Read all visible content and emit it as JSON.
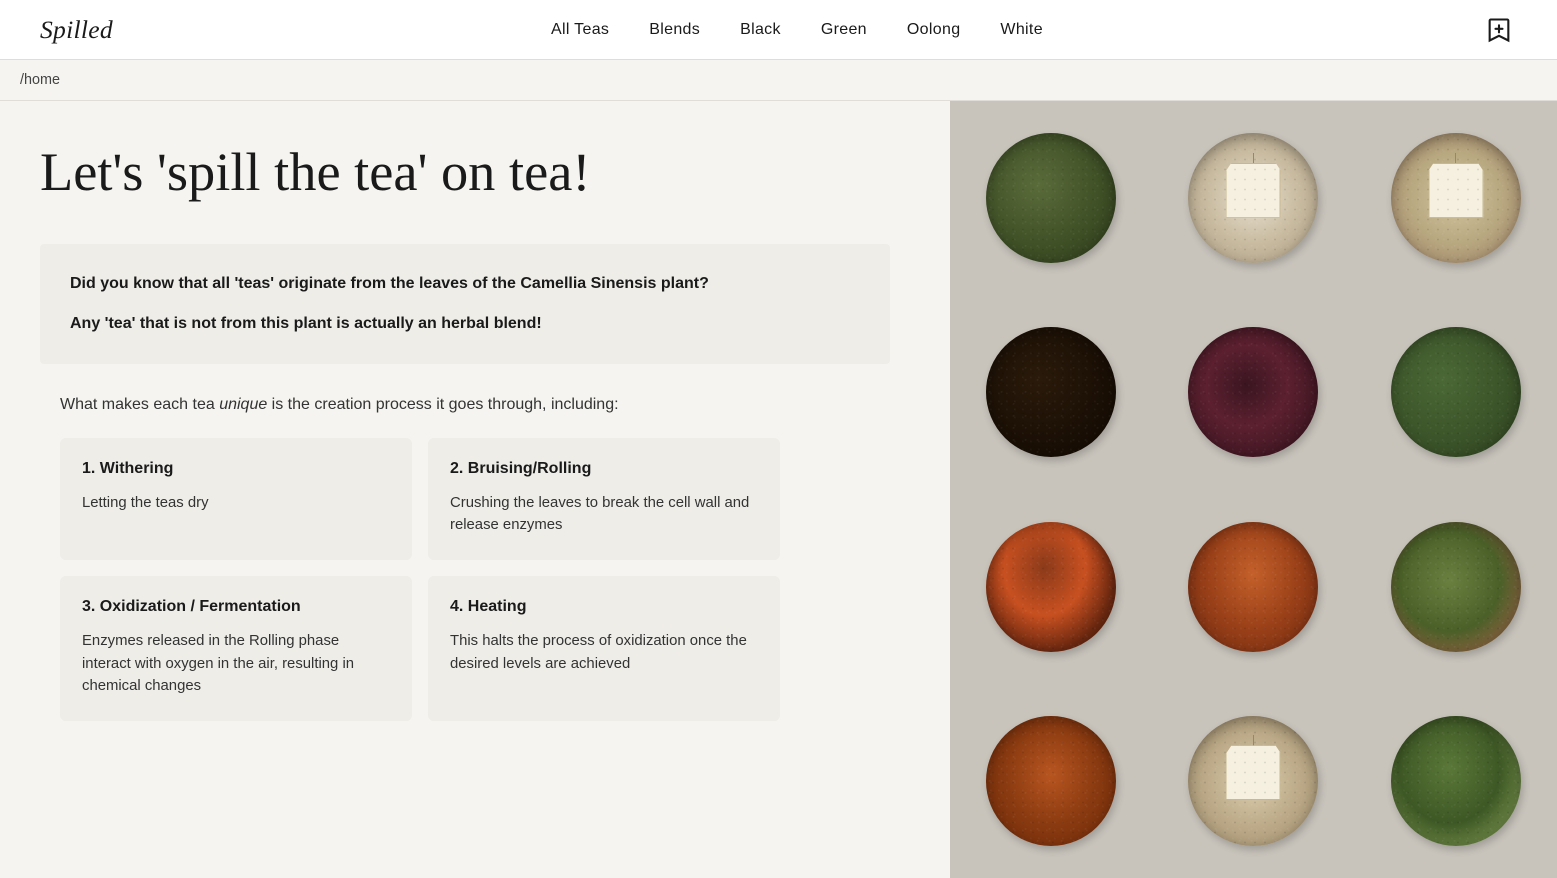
{
  "site": {
    "logo": "Spilled"
  },
  "nav": {
    "links": [
      {
        "id": "all-teas",
        "label": "All Teas"
      },
      {
        "id": "blends",
        "label": "Blends"
      },
      {
        "id": "black",
        "label": "Black"
      },
      {
        "id": "green",
        "label": "Green"
      },
      {
        "id": "oolong",
        "label": "Oolong"
      },
      {
        "id": "white",
        "label": "White"
      }
    ]
  },
  "breadcrumb": "/home",
  "hero": {
    "title": "Let's 'spill the tea' on tea!"
  },
  "facts": {
    "line1": "Did you know that all 'teas' originate from the leaves of the Camellia Sinensis plant?",
    "line2": "Any 'tea' that is not from this plant is actually an herbal blend!"
  },
  "process": {
    "intro_prefix": "What makes each tea ",
    "intro_italic": "unique",
    "intro_suffix": " is the creation process it goes through, including:",
    "cards": [
      {
        "id": "withering",
        "title": "1. Withering",
        "body": "Letting the teas dry"
      },
      {
        "id": "bruising",
        "title": "2. Bruising/Rolling",
        "body": "Crushing the leaves to break the cell wall and release enzymes"
      },
      {
        "id": "oxidization",
        "title": "3. Oxidization / Fermentation",
        "body": "Enzymes released in the Rolling phase interact with oxygen in the air, resulting in chemical changes"
      },
      {
        "id": "heating",
        "title": "4. Heating",
        "body": "This halts the process of oxidization once the desired levels are achieved"
      }
    ]
  },
  "image_panel": {
    "alt": "Various tea types in bowls",
    "bowls": [
      {
        "id": "bowl-1",
        "type": "green-loose",
        "class": "bowl-green-loose"
      },
      {
        "id": "bowl-2",
        "type": "white-bags",
        "class": "bowl-white-bags",
        "hasBag": true
      },
      {
        "id": "bowl-3",
        "type": "bagged-fruit",
        "class": "bowl-bagged-fruit",
        "hasBag": true
      },
      {
        "id": "bowl-4",
        "type": "dark-black",
        "class": "bowl-dark-black"
      },
      {
        "id": "bowl-5",
        "type": "black-berry",
        "class": "bowl-black-berry"
      },
      {
        "id": "bowl-6",
        "type": "green-leaf",
        "class": "bowl-green-leaf"
      },
      {
        "id": "bowl-7",
        "type": "red-herbal",
        "class": "bowl-red-herbal"
      },
      {
        "id": "bowl-8",
        "type": "rooibos",
        "class": "bowl-rooibos"
      },
      {
        "id": "bowl-9",
        "type": "mixed-green",
        "class": "bowl-mixed-green"
      },
      {
        "id": "bowl-10",
        "type": "rooibos2",
        "class": "bowl-rooibos2"
      },
      {
        "id": "bowl-11",
        "type": "white-bag2",
        "class": "bowl-white-bag2",
        "hasBag": true
      },
      {
        "id": "bowl-12",
        "type": "green-mixed",
        "class": "bowl-green-mixed"
      }
    ]
  }
}
